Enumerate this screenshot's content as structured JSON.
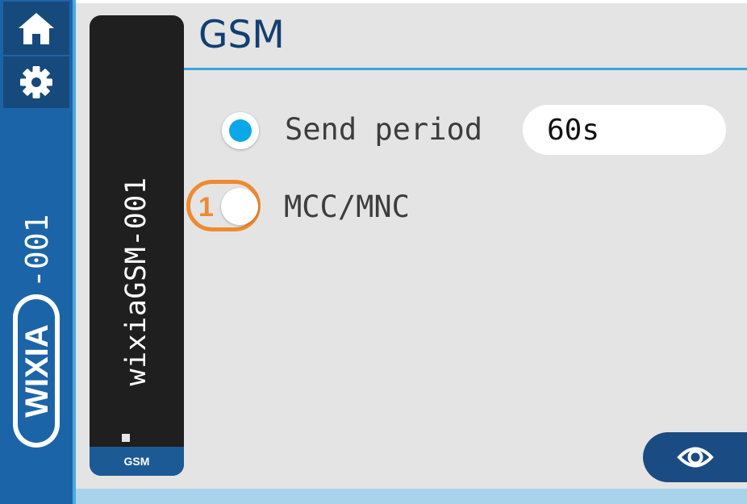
{
  "sidebar": {
    "home_icon": "home-icon",
    "settings_icon": "gear-icon",
    "logo_text": "WIXIA",
    "device_suffix": "-001"
  },
  "device": {
    "name": "wixiaGSM-001",
    "footer_label": "GSM"
  },
  "page": {
    "title": "GSM"
  },
  "options": [
    {
      "label": "Send period",
      "selected": true
    },
    {
      "label": "MCC/MNC",
      "selected": false
    }
  ],
  "send_period": {
    "value": "60s"
  },
  "callout": {
    "number": "1"
  },
  "view_button": {
    "icon": "eye-icon"
  },
  "colors": {
    "sidebar": "#1c64a8",
    "nav_button": "#174a7c",
    "accent": "#0aa8e8",
    "title": "#123f72",
    "callout": "#ef8a2f"
  }
}
